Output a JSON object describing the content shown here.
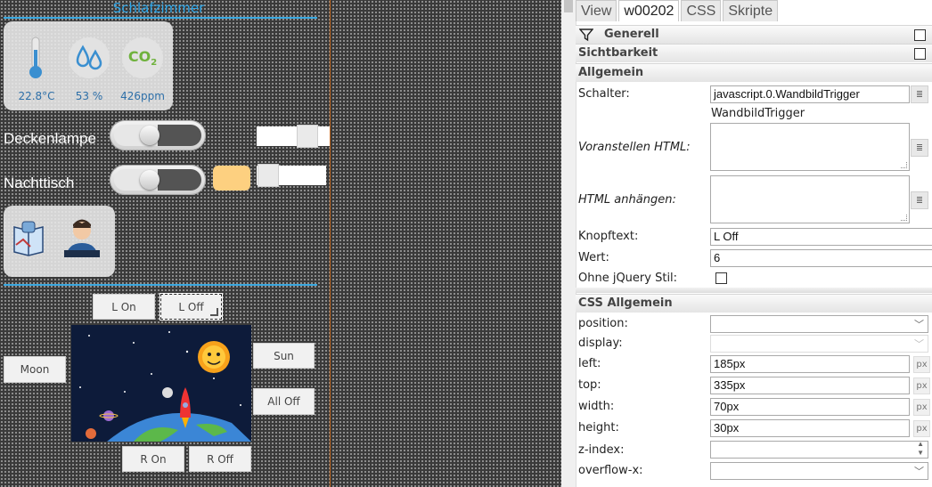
{
  "canvas": {
    "room_title": "Schlafzimmer",
    "sensors": [
      {
        "icon": "thermometer-icon",
        "value": "22.8°C"
      },
      {
        "icon": "humidity-drops-icon",
        "value": "53 %"
      },
      {
        "icon": "co2-icon",
        "value": "426ppm",
        "symbol": "CO",
        "symbol_sub": "2"
      }
    ],
    "switches": [
      {
        "label": "Deckenlampe",
        "state": "off",
        "level": 0.78
      },
      {
        "label": "Nachttisch",
        "state": "off",
        "level": 0.02,
        "color": "#fdd080"
      }
    ],
    "buttons": {
      "l_on": "L On",
      "l_off": "L Off",
      "moon": "Moon",
      "sun": "Sun",
      "all_off": "All Off",
      "r_on": "R On",
      "r_off": "R Off"
    }
  },
  "panel": {
    "tabs": [
      "View",
      "w00202",
      "CSS",
      "Skripte"
    ],
    "active_tab": "w00202",
    "sections": {
      "generell": "Generell",
      "sichtbarkeit": "Sichtbarkeit",
      "allgemein": "Allgemein",
      "css_allgemein": "CSS Allgemein"
    },
    "fields": {
      "schalter_label": "Schalter:",
      "schalter_value": "javascript.0.WandbildTrigger",
      "schalter_hint": "WandbildTrigger",
      "voranstellen_label": "Voranstellen HTML:",
      "anhaengen_label": "HTML anhängen:",
      "knopftext_label": "Knopftext:",
      "knopftext_value": "L Off",
      "wert_label": "Wert:",
      "wert_value": "6",
      "jquery_label": "Ohne jQuery Stil:",
      "position_label": "position:",
      "display_label": "display:",
      "left_label": "left:",
      "left_value": "185px",
      "top_label": "top:",
      "top_value": "335px",
      "width_label": "width:",
      "width_value": "70px",
      "height_label": "height:",
      "height_value": "30px",
      "zindex_label": "z-index:",
      "overflowx_label": "overflow-x:",
      "unit": "px"
    }
  },
  "colors": {
    "accent_blue": "#39a8e0",
    "canvas_bg": "#3a3a3a",
    "divider": "#c0661e"
  }
}
